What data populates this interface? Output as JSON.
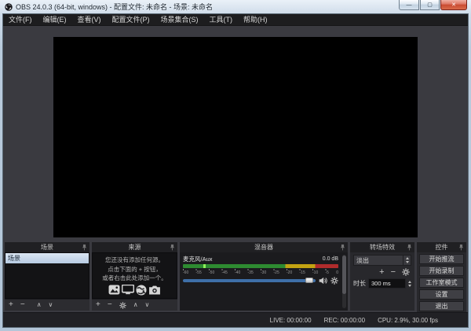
{
  "window": {
    "title": "OBS 24.0.3 (64-bit, windows) - 配置文件: 未命名 - 场景: 未命名",
    "controls": {
      "minimize": "—",
      "maximize": "▢",
      "close": "✕"
    }
  },
  "menu": {
    "items": [
      {
        "label": "文件(F)"
      },
      {
        "label": "编辑(E)"
      },
      {
        "label": "查看(V)"
      },
      {
        "label": "配置文件(P)"
      },
      {
        "label": "场景集合(S)"
      },
      {
        "label": "工具(T)"
      },
      {
        "label": "帮助(H)"
      }
    ]
  },
  "scenes": {
    "title": "场景",
    "items": [
      {
        "label": "场景",
        "selected": true
      }
    ],
    "toolbar": {
      "add": "+",
      "remove": "−",
      "up": "∧",
      "down": "∨"
    }
  },
  "sources": {
    "title": "来源",
    "empty_line1": "您还没有添加任何源。",
    "empty_line2": "点击下面的 + 按钮，",
    "empty_line3": "或者右击此处添加一个。",
    "toolbar": {
      "add": "+",
      "remove": "−",
      "up": "∧",
      "down": "∨"
    }
  },
  "mixer": {
    "title": "混音器",
    "channel": {
      "name": "麦克风/Aux",
      "level": "0.0 dB",
      "volume_percent": 97,
      "ticks": [
        "-60",
        "-55",
        "-50",
        "-45",
        "-40",
        "-35",
        "-30",
        "-25",
        "-20",
        "-15",
        "-10",
        "-5",
        "0"
      ]
    }
  },
  "transitions": {
    "title": "转场特效",
    "selected": "淡出",
    "toolbar": {
      "add": "+",
      "remove": "−"
    },
    "duration_label": "时长",
    "duration_value": "300 ms"
  },
  "controls": {
    "title": "控件",
    "buttons": [
      {
        "label": "开始推流"
      },
      {
        "label": "开始录制"
      },
      {
        "label": "工作室模式"
      },
      {
        "label": "设置"
      },
      {
        "label": "退出"
      }
    ]
  },
  "statusbar": {
    "live": "LIVE: 00:00:00",
    "rec": "REC: 00:00:00",
    "cpu": "CPU: 2.9%, 30.00 fps"
  },
  "colors": {
    "slider_blue": "#3e6fa8",
    "meter_green": "#2e8b31",
    "meter_yellow": "#c3a312",
    "meter_red": "#b02c2c",
    "selection_blue": "#b7cbe2",
    "close_red": "#c94a31"
  }
}
